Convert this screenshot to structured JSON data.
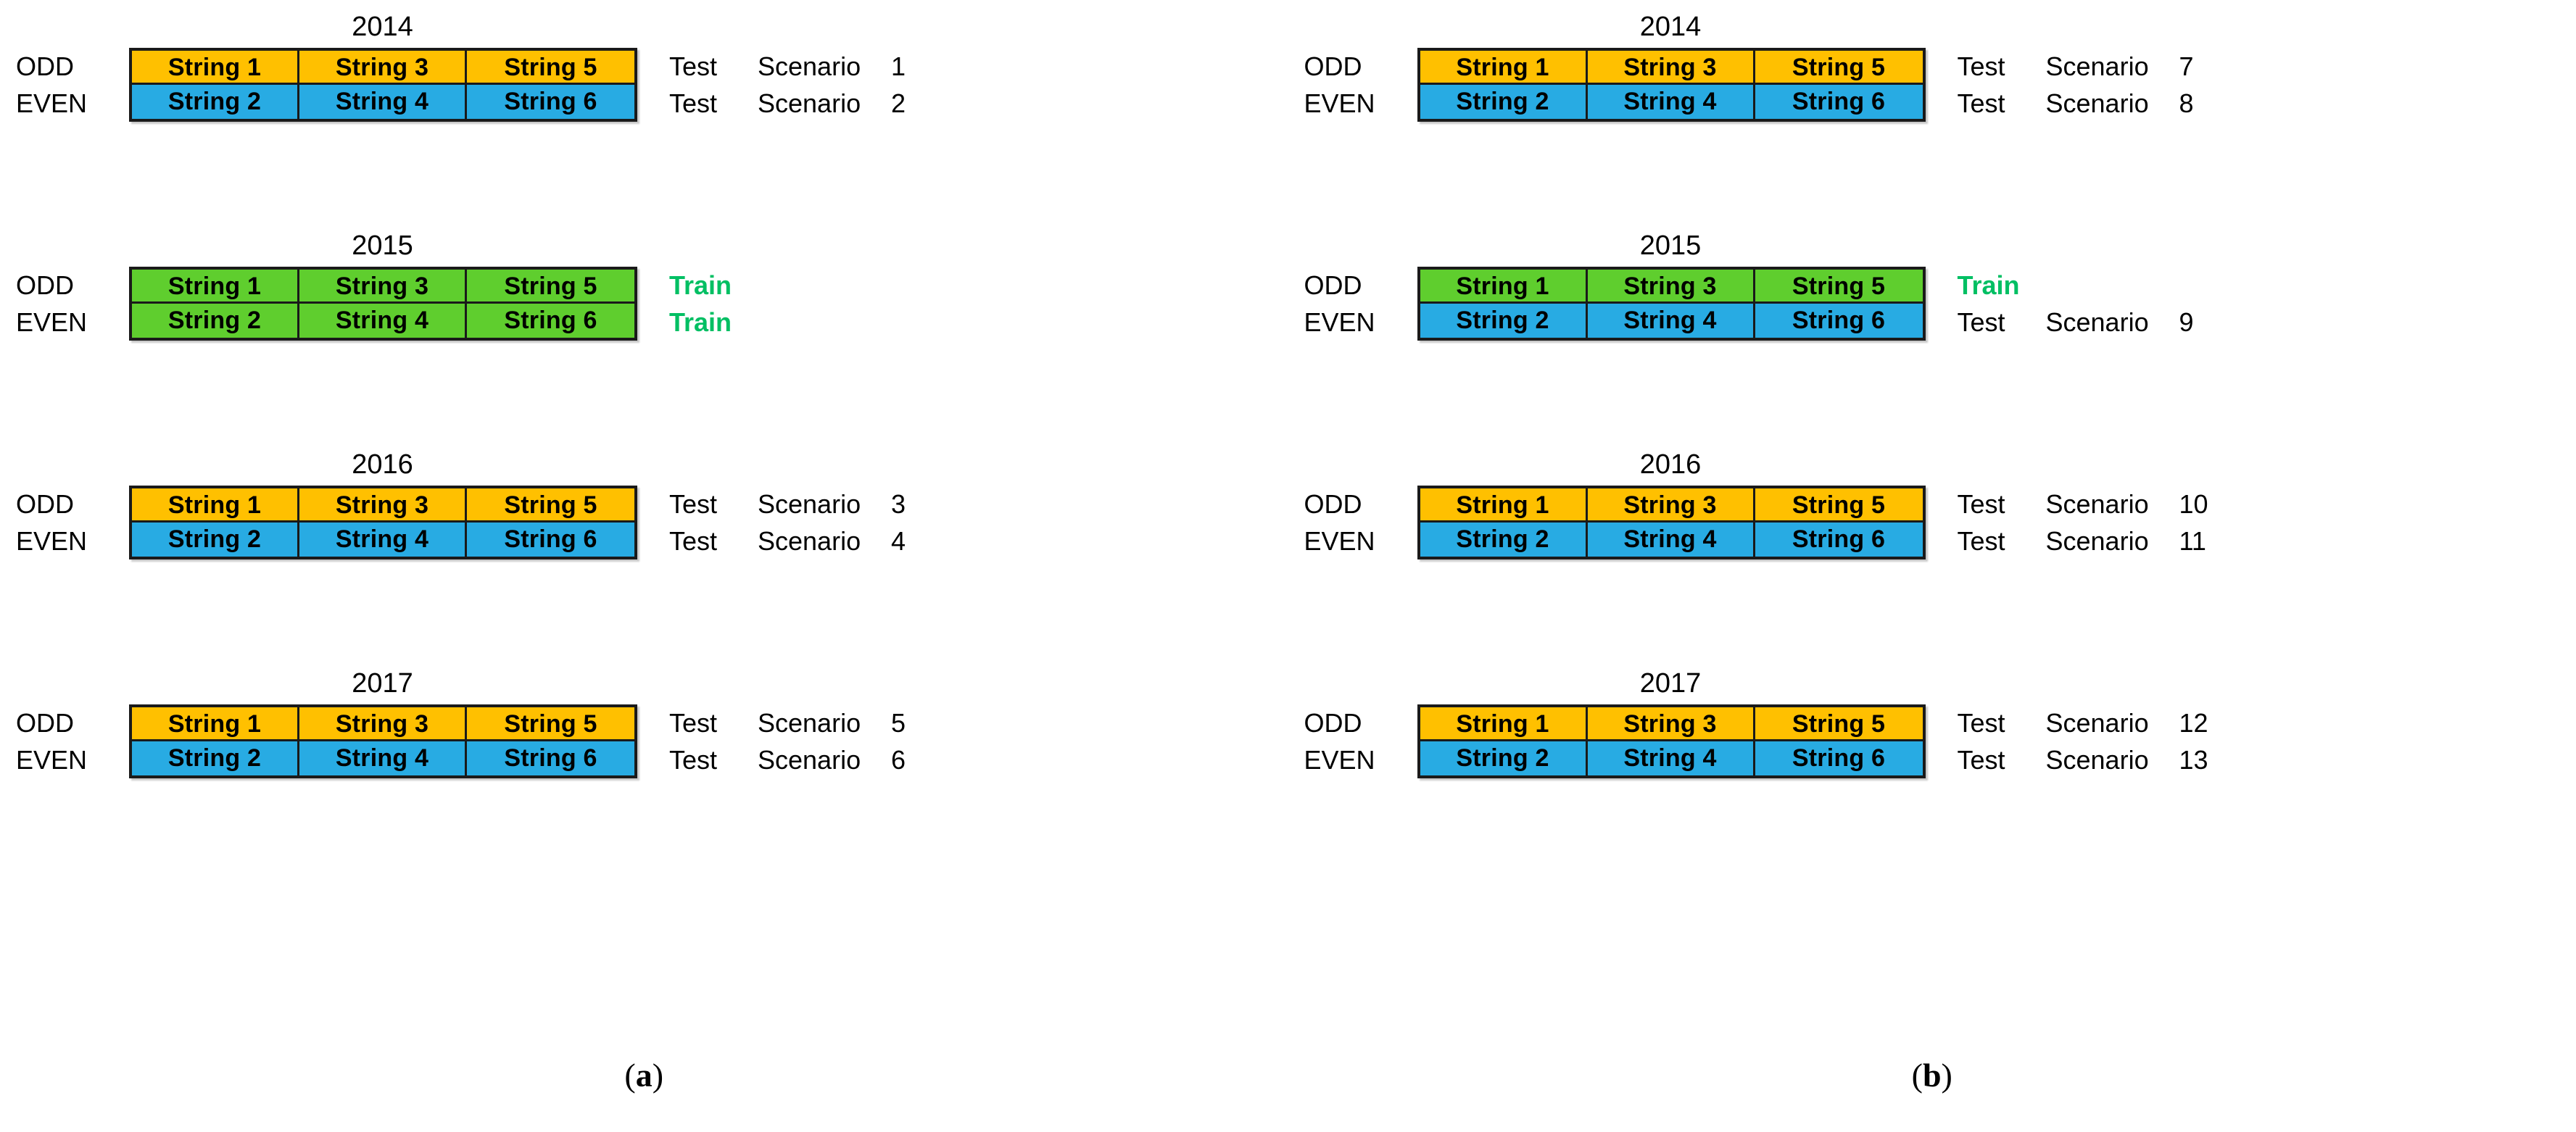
{
  "figure": {
    "row_labels": {
      "odd": "ODD",
      "even": "EVEN"
    },
    "colors": {
      "orange": "#ffc000",
      "blue": "#28abe3",
      "green": "#5fce2e",
      "train_text": "#00bf63",
      "border": "#1a1a1a",
      "background": "#ffffff"
    },
    "panels": [
      {
        "caption_open": "(",
        "caption_letter": "a",
        "caption_close": ")",
        "blocks": [
          {
            "year": "2014",
            "rows": [
              {
                "side": "ODD",
                "color": "orange",
                "cells": [
                  "String 1",
                  "String 3",
                  "String 5"
                ],
                "kind": "Test",
                "scenario_label": "Scenario",
                "scenario_number": "1"
              },
              {
                "side": "EVEN",
                "color": "blue",
                "cells": [
                  "String 2",
                  "String 4",
                  "String 6"
                ],
                "kind": "Test",
                "scenario_label": "Scenario",
                "scenario_number": "2"
              }
            ]
          },
          {
            "year": "2015",
            "rows": [
              {
                "side": "ODD",
                "color": "green",
                "cells": [
                  "String 1",
                  "String 3",
                  "String 5"
                ],
                "kind": "Train",
                "scenario_label": "",
                "scenario_number": ""
              },
              {
                "side": "EVEN",
                "color": "green",
                "cells": [
                  "String 2",
                  "String 4",
                  "String 6"
                ],
                "kind": "Train",
                "scenario_label": "",
                "scenario_number": ""
              }
            ]
          },
          {
            "year": "2016",
            "rows": [
              {
                "side": "ODD",
                "color": "orange",
                "cells": [
                  "String 1",
                  "String 3",
                  "String 5"
                ],
                "kind": "Test",
                "scenario_label": "Scenario",
                "scenario_number": "3"
              },
              {
                "side": "EVEN",
                "color": "blue",
                "cells": [
                  "String 2",
                  "String 4",
                  "String 6"
                ],
                "kind": "Test",
                "scenario_label": "Scenario",
                "scenario_number": "4"
              }
            ]
          },
          {
            "year": "2017",
            "rows": [
              {
                "side": "ODD",
                "color": "orange",
                "cells": [
                  "String 1",
                  "String 3",
                  "String 5"
                ],
                "kind": "Test",
                "scenario_label": "Scenario",
                "scenario_number": "5"
              },
              {
                "side": "EVEN",
                "color": "blue",
                "cells": [
                  "String 2",
                  "String 4",
                  "String 6"
                ],
                "kind": "Test",
                "scenario_label": "Scenario",
                "scenario_number": "6"
              }
            ]
          }
        ]
      },
      {
        "caption_open": "(",
        "caption_letter": "b",
        "caption_close": ")",
        "blocks": [
          {
            "year": "2014",
            "rows": [
              {
                "side": "ODD",
                "color": "orange",
                "cells": [
                  "String 1",
                  "String 3",
                  "String 5"
                ],
                "kind": "Test",
                "scenario_label": "Scenario",
                "scenario_number": "7"
              },
              {
                "side": "EVEN",
                "color": "blue",
                "cells": [
                  "String 2",
                  "String 4",
                  "String 6"
                ],
                "kind": "Test",
                "scenario_label": "Scenario",
                "scenario_number": "8"
              }
            ]
          },
          {
            "year": "2015",
            "rows": [
              {
                "side": "ODD",
                "color": "green",
                "cells": [
                  "String 1",
                  "String 3",
                  "String 5"
                ],
                "kind": "Train",
                "scenario_label": "",
                "scenario_number": ""
              },
              {
                "side": "EVEN",
                "color": "blue",
                "cells": [
                  "String 2",
                  "String 4",
                  "String 6"
                ],
                "kind": "Test",
                "scenario_label": "Scenario",
                "scenario_number": "9"
              }
            ]
          },
          {
            "year": "2016",
            "rows": [
              {
                "side": "ODD",
                "color": "orange",
                "cells": [
                  "String 1",
                  "String 3",
                  "String 5"
                ],
                "kind": "Test",
                "scenario_label": "Scenario",
                "scenario_number": "10"
              },
              {
                "side": "EVEN",
                "color": "blue",
                "cells": [
                  "String 2",
                  "String 4",
                  "String 6"
                ],
                "kind": "Test",
                "scenario_label": "Scenario",
                "scenario_number": "11"
              }
            ]
          },
          {
            "year": "2017",
            "rows": [
              {
                "side": "ODD",
                "color": "orange",
                "cells": [
                  "String 1",
                  "String 3",
                  "String 5"
                ],
                "kind": "Test",
                "scenario_label": "Scenario",
                "scenario_number": "12"
              },
              {
                "side": "EVEN",
                "color": "blue",
                "cells": [
                  "String 2",
                  "String 4",
                  "String 6"
                ],
                "kind": "Test",
                "scenario_label": "Scenario",
                "scenario_number": "13"
              }
            ]
          }
        ]
      }
    ]
  }
}
